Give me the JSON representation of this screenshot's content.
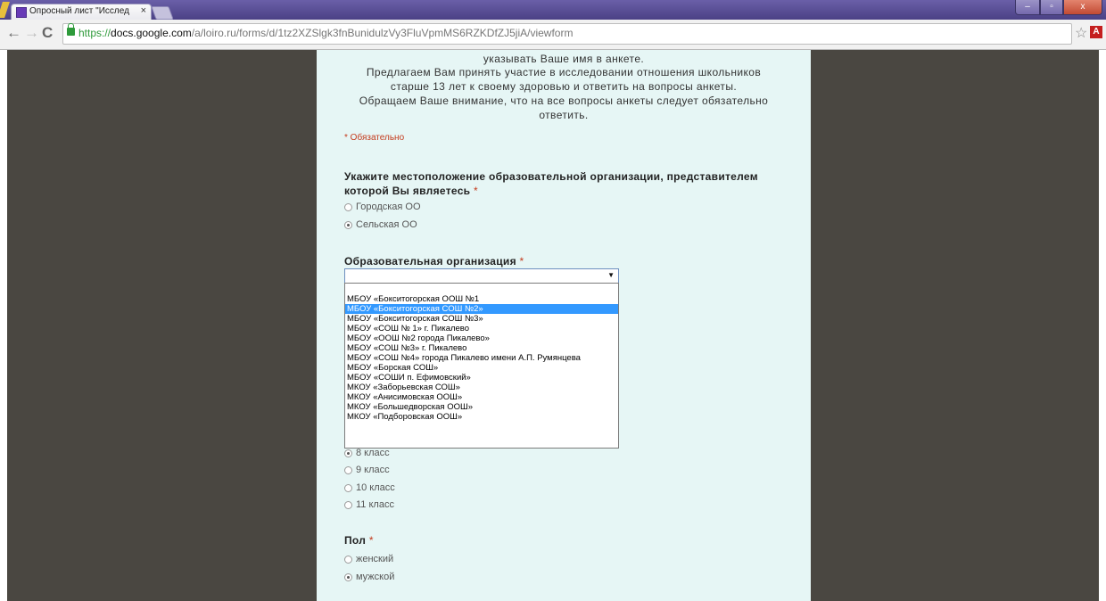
{
  "browser": {
    "tab_title": "Опросный лист \"Исслед",
    "tab_close": "×",
    "url_scheme": "https://",
    "url_host": "docs.google.com",
    "url_path": "/a/loiro.ru/forms/d/1tz2XZSlgk3fnBunidulzVy3FluVpmMS6RZKDfZJ5jiA/viewform",
    "back": "←",
    "forward": "→",
    "reload": "C",
    "star": "☆",
    "pdf": "A",
    "win_min": "–",
    "win_max": "▫",
    "win_close": "x"
  },
  "form": {
    "intro_lines": [
      "указывать Ваше имя в анкете.",
      "Предлагаем Вам принять участие в исследовании отношения школьников",
      "старше 13 лет к своему здоровью и ответить на вопросы анкеты.",
      "Обращаем Ваше внимание, что на все вопросы анкеты следует обязательно",
      "ответить."
    ],
    "required_note": "* Обязательно",
    "q_location": {
      "title_line1": "Укажите местоположение образовательной организации, представителем",
      "title_line2": "которой Вы являетесь",
      "asterisk": "*",
      "options": [
        "Городская ОО",
        "Сельская ОО"
      ],
      "selected": "Сельская ОО"
    },
    "q_org": {
      "title": "Образовательная организация",
      "asterisk": "*",
      "value": "",
      "dropdown_arrow": "▼",
      "options": [
        "МБОУ «Бокситогорская ООШ №1",
        "МБОУ «Бокситогорская СОШ №2»",
        "МБОУ «Бокситогорская СОШ №3»",
        "МБОУ «СОШ № 1» г. Пикалево",
        "МБОУ «ООШ №2 города Пикалево»",
        "МБОУ «СОШ №3» г. Пикалево",
        "МБОУ «СОШ №4» города Пикалево имени А.П. Румянцева",
        "МБОУ «Борская СОШ»",
        "МБОУ «СОШИ п. Ефимовский»",
        "МКОУ «Заборьевская СОШ»",
        "МКОУ «Анисимовская ООШ»",
        "МКОУ «Большедворская ООШ»",
        "МКОУ «Подборовская ООШ»"
      ],
      "highlighted": "МБОУ «Бокситогорская СОШ №2»"
    },
    "q_grade": {
      "options": [
        "8 класс",
        "9 класс",
        "10 класс",
        "11 класс"
      ],
      "selected": "8 класс"
    },
    "q_gender": {
      "title": "Пол",
      "asterisk": "*",
      "options": [
        "женский",
        "мужской"
      ],
      "selected": "мужской"
    }
  }
}
